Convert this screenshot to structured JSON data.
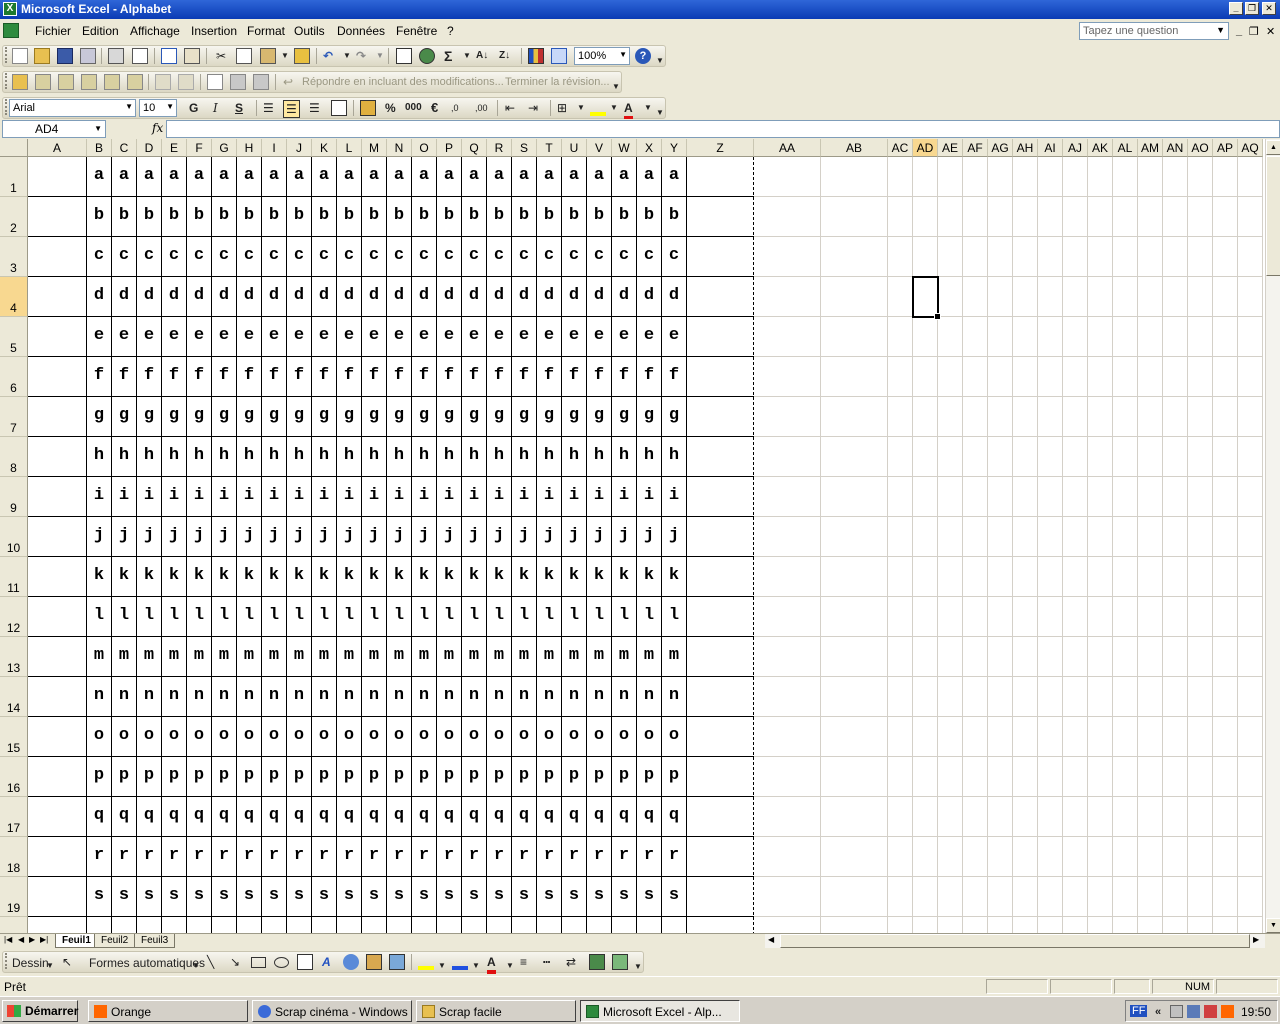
{
  "window": {
    "title": "Microsoft Excel - Alphabet"
  },
  "menu": {
    "items": [
      "Fichier",
      "Edition",
      "Affichage",
      "Insertion",
      "Format",
      "Outils",
      "Données",
      "Fenêtre",
      "?"
    ],
    "ask_placeholder": "Tapez une question"
  },
  "toolbar_standard": {
    "zoom": "100%"
  },
  "toolbar_review": {
    "reply_label": "Répondre en incluant des modifications...",
    "end_review_label": "Terminer la révision..."
  },
  "toolbar_format": {
    "font": "Arial",
    "size": "10"
  },
  "formula_bar": {
    "name_box": "AD4",
    "fx": "fx",
    "content": ""
  },
  "grid": {
    "columns": [
      "A",
      "B",
      "C",
      "D",
      "E",
      "F",
      "G",
      "H",
      "I",
      "J",
      "K",
      "L",
      "M",
      "N",
      "O",
      "P",
      "Q",
      "R",
      "S",
      "T",
      "U",
      "V",
      "W",
      "X",
      "Y",
      "Z",
      "AA",
      "AB",
      "AC",
      "AD",
      "AE",
      "AF",
      "AG",
      "AH",
      "AI",
      "AJ",
      "AK",
      "AL",
      "AM",
      "AN",
      "AO",
      "AP",
      "AQ"
    ],
    "rows": [
      "1",
      "2",
      "3",
      "4",
      "5",
      "6",
      "7",
      "8",
      "9",
      "10",
      "11",
      "12",
      "13",
      "14",
      "15",
      "16",
      "17",
      "18",
      "19"
    ],
    "row_letters": [
      "a",
      "b",
      "c",
      "d",
      "e",
      "f",
      "g",
      "h",
      "i",
      "j",
      "k",
      "l",
      "m",
      "n",
      "o",
      "p",
      "q",
      "r",
      "s"
    ],
    "filled_columns": "B-Y",
    "active_cell": "AD4"
  },
  "sheets": {
    "tabs": [
      "Feuil1",
      "Feuil2",
      "Feuil3"
    ],
    "active": "Feuil1"
  },
  "drawing_toolbar": {
    "draw_label": "Dessin",
    "autoshapes_label": "Formes automatiques"
  },
  "statusbar": {
    "status": "Prêt",
    "num": "NUM"
  },
  "taskbar": {
    "start": "Démarrer",
    "buttons": [
      "Orange",
      "Scrap cinéma - Windows ...",
      "Scrap facile",
      "Microsoft Excel - Alp..."
    ],
    "active_button": "Microsoft Excel - Alp...",
    "lang": "FF",
    "clock": "19:50"
  }
}
